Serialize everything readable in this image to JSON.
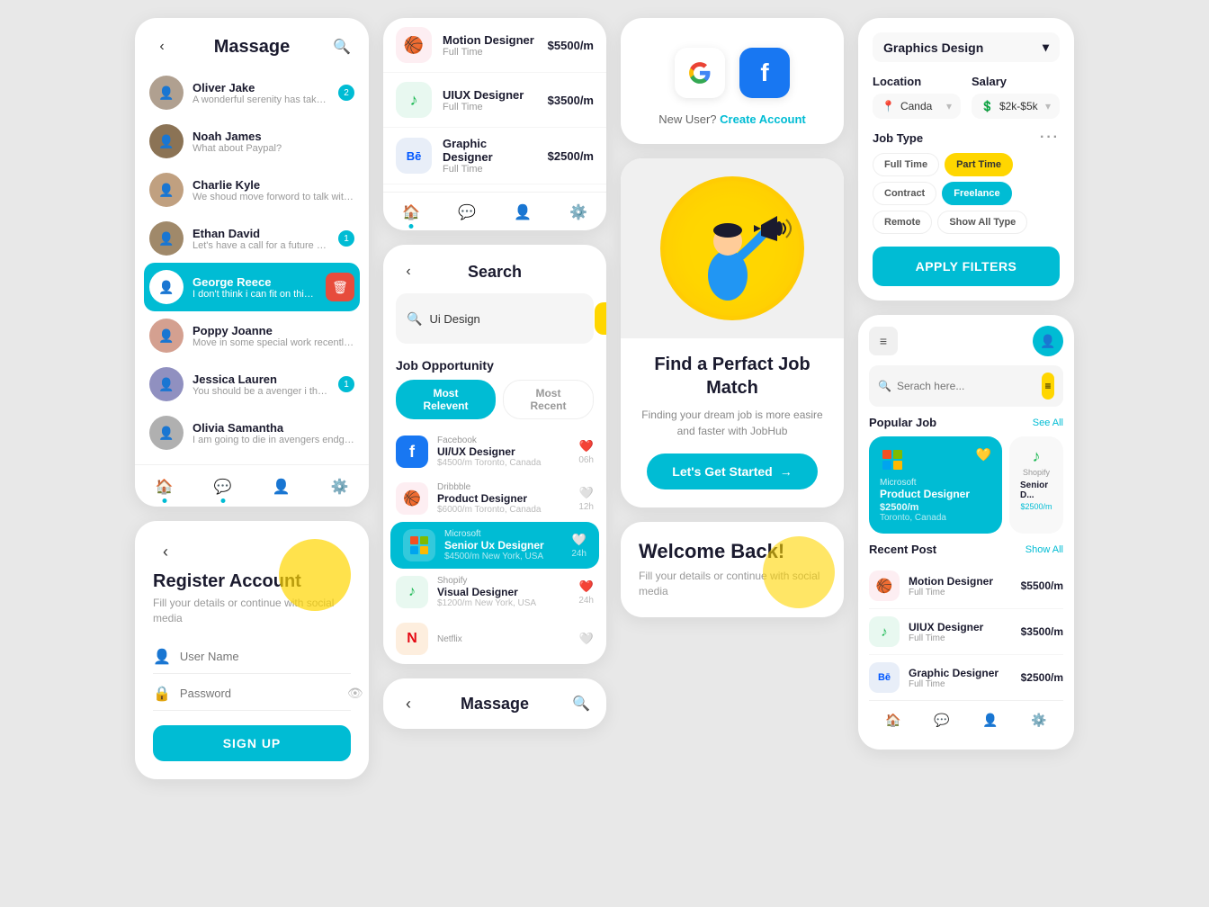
{
  "col1": {
    "massage": {
      "title": "Massage",
      "chats": [
        {
          "name": "Oliver Jake",
          "preview": "A wonderful serenity has taken...",
          "badge": "2",
          "avatarClass": "a1"
        },
        {
          "name": "Noah James",
          "preview": "What about Paypal?",
          "badge": "",
          "avatarClass": "a2"
        },
        {
          "name": "Charlie Kyle",
          "preview": "We shoud move forword to talk with...",
          "badge": "",
          "avatarClass": "a3"
        },
        {
          "name": "Ethan David",
          "preview": "Let's have a call for a future projects...",
          "badge": "1",
          "avatarClass": "a4"
        },
        {
          "name": "George Reece",
          "preview": "I don't think i can fit on this ui we should...",
          "badge": "",
          "avatarClass": "a5",
          "active": true,
          "delete": true
        },
        {
          "name": "Poppy Joanne",
          "preview": "Move in some special work recently so...",
          "badge": "",
          "avatarClass": "a6"
        },
        {
          "name": "Jessica Lauren",
          "preview": "You should be a avenger i thing the...",
          "badge": "1",
          "avatarClass": "a7"
        },
        {
          "name": "Olivia Samantha",
          "preview": "I am going to die in avengers endgame...",
          "badge": "",
          "avatarClass": "a8"
        }
      ]
    },
    "register": {
      "title": "Register Account",
      "subtitle": "Fill your details or continue with social media",
      "usernamePlaceholder": "User Name",
      "passwordPlaceholder": "Password",
      "signupLabel": "SIGN UP"
    }
  },
  "col2": {
    "jobList": {
      "items": [
        {
          "logo": "dribbble",
          "company": "Motion Designer",
          "type": "Full Time",
          "salary": "$5500/m",
          "logoChar": "🏀"
        },
        {
          "logo": "spotify",
          "company": "UIUX Designer",
          "type": "Full Time",
          "salary": "$3500/m",
          "logoChar": "🎵"
        },
        {
          "logo": "behance",
          "company": "Graphic Designer",
          "type": "Full Time",
          "salary": "$2500/m",
          "logoChar": "Bē"
        }
      ]
    },
    "search": {
      "title": "Search",
      "searchPlaceholder": "Ui Design",
      "sectionLabel": "Job Opportunity",
      "tabs": [
        "Most Relevent",
        "Most Recent"
      ],
      "jobs": [
        {
          "company": "Facebook",
          "title": "UI/UX Designer",
          "meta": "$4500/m  Toronto, Canada",
          "time": "06h",
          "heart": true,
          "logoClass": "fb",
          "logoChar": "f",
          "highlighted": false
        },
        {
          "company": "Dribbble",
          "title": "Product Designer",
          "meta": "$6000/m  Toronto, Canada",
          "time": "12h",
          "heart": false,
          "logoClass": "dr",
          "logoChar": "🏀",
          "highlighted": false
        },
        {
          "company": "Microsoft",
          "title": "Senior Ux Designer",
          "meta": "$4500/m  New York, USA",
          "time": "24h",
          "heart": false,
          "logoClass": "ms-white",
          "logoChar": "⊞",
          "highlighted": true
        },
        {
          "company": "Shopify",
          "title": "Visual Designer",
          "meta": "$1200/m  New York, USA",
          "time": "24h",
          "heart": true,
          "logoClass": "sp",
          "logoChar": "🎵",
          "highlighted": false
        },
        {
          "company": "Netflix",
          "title": "",
          "meta": "",
          "time": "",
          "heart": false,
          "logoClass": "nf",
          "logoChar": "N",
          "highlighted": false
        }
      ]
    }
  },
  "col3": {
    "social": {
      "newUserText": "New User?",
      "createAccountText": "Create Account"
    },
    "hero": {
      "heading": "Find a Perfact Job Match",
      "subtitle": "Finding your dream job is more easire and faster with JobHub",
      "btnLabel": "Let's Get Started"
    },
    "welcome": {
      "title": "Welcome Back!",
      "subtitle": "Fill your details or continue with social media"
    }
  },
  "col4": {
    "filter": {
      "category": "Graphics Design",
      "locationLabel": "Location",
      "salaryLabel": "Salary",
      "locationValue": "Canda",
      "salaryValue": "$2k-$5k",
      "jobTypeLabel": "Job Type",
      "tags": [
        {
          "label": "Full Time",
          "active": false
        },
        {
          "label": "Part Time",
          "active": true
        },
        {
          "label": "Contract",
          "active": false
        },
        {
          "label": "Freelance",
          "active": true
        },
        {
          "label": "Remote",
          "active": false
        },
        {
          "label": "Show All Type",
          "active": false
        }
      ],
      "applyLabel": "APPLY FILTERS"
    },
    "jobSearch": {
      "searchPlaceholder": "Serach here...",
      "popularLabel": "Popular Job",
      "seeAllLabel": "See All",
      "popularJobs": [
        {
          "company": "Microsoft",
          "title": "Product Designer",
          "salary": "$2500/m",
          "location": "Toronto, Canada"
        },
        {
          "company": "Shopify",
          "title": "Senior D...",
          "salary": "$2500/m",
          "location": ""
        }
      ],
      "recentLabel": "Recent Post",
      "showAllLabel": "Show All",
      "recentJobs": [
        {
          "logo": "dr2",
          "logoChar": "🏀",
          "title": "Motion Designer",
          "type": "Full Time",
          "salary": "$5500/m"
        },
        {
          "logo": "sp2",
          "logoChar": "🎵",
          "title": "UIUX Designer",
          "type": "Full Time",
          "salary": "$3500/m"
        },
        {
          "logo": "be2",
          "logoChar": "Bē",
          "title": "Graphic Designer",
          "type": "Full Time",
          "salary": "$2500/m"
        }
      ]
    },
    "massage2": {
      "title": "Massage"
    }
  }
}
